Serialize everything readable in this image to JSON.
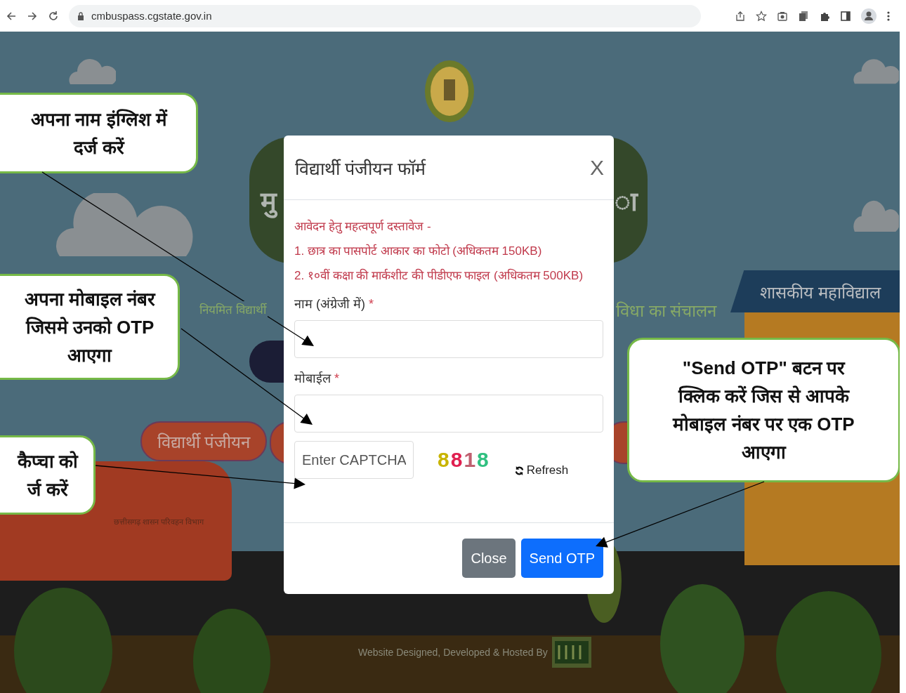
{
  "browser": {
    "url": "cmbuspass.cgstate.gov.in"
  },
  "background": {
    "title_left": "मु",
    "title_right": "ा",
    "left_caption": "नियमित विद्यार्थी",
    "right_caption": "विधा का संचालन",
    "college_sign": "शासकीय महाविद्याल",
    "buttons": [
      {
        "label": "विद्यार्थी पंजीयन"
      }
    ],
    "bus_text": "छत्तीसगढ़ शासन परिवहन विभाग",
    "footer_text": "Website Designed, Developed & Hosted By"
  },
  "modal": {
    "title": "विद्यार्थी पंजीयन फॉर्म",
    "close_icon": "X",
    "notice": [
      "आवेदन हेतु महत्वपूर्ण दस्तावेज -",
      "1. छात्र का पासपोर्ट आकार का फोटो (अधिकतम 150KB)",
      "2. १०वीं कक्षा की मार्कशीट की पीडीएफ फाइल (अधिकतम 500KB)"
    ],
    "fields": [
      {
        "label": "नाम (अंग्रेजी में)",
        "required_mark": "*"
      },
      {
        "label": "मोबाईल",
        "required_mark": "*"
      }
    ],
    "captcha": {
      "placeholder": "Enter CAPTCHA",
      "image_text": "8818",
      "refresh": "Refresh"
    },
    "buttons": [
      {
        "label": "Close",
        "kind": "secondary"
      },
      {
        "label": "Send OTP",
        "kind": "primary"
      }
    ]
  },
  "callouts": [
    {
      "lines": [
        "अपना नाम इंग्लिश में",
        "दर्ज करें"
      ]
    },
    {
      "lines": [
        "अपना मोबाइल नंबर",
        "जिसमे उनको OTP",
        "आएगा"
      ]
    },
    {
      "lines": [
        "कैप्चा को",
        "र्ज करें"
      ]
    },
    {
      "lines": [
        "\"Send OTP\" बटन पर",
        "क्लिक करें जिस से आपके",
        "मोबाइल नंबर पर एक OTP",
        "आएगा"
      ]
    }
  ]
}
